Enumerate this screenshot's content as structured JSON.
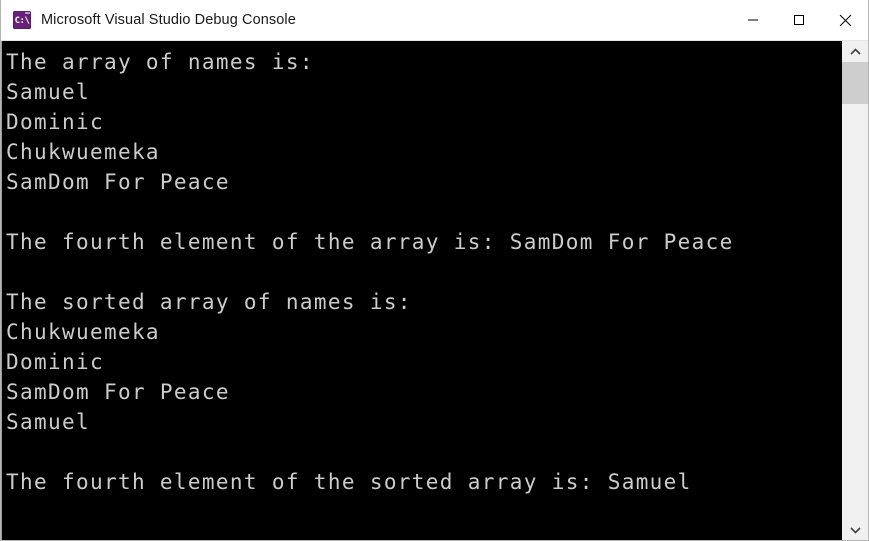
{
  "window": {
    "title": "Microsoft Visual Studio Debug Console",
    "icon_name": "console-app-icon",
    "icon_glyph": "C:\\",
    "icon_color": "#68217a",
    "titlebar_bg": "#ffffff",
    "title_color": "#1a1a1a"
  },
  "controls": {
    "minimize_label": "Minimize",
    "maximize_label": "Maximize",
    "close_label": "Close"
  },
  "console": {
    "background": "#000000",
    "foreground": "#cccccc",
    "lines": [
      "The array of names is:",
      "Samuel",
      "Dominic",
      "Chukwuemeka",
      "SamDom For Peace",
      "",
      "The fourth element of the array is: SamDom For Peace",
      "",
      "The sorted array of names is:",
      "Chukwuemeka",
      "Dominic",
      "SamDom For Peace",
      "Samuel",
      "",
      "The fourth element of the sorted array is: Samuel",
      ""
    ]
  },
  "scrollbar": {
    "up_arrow_label": "Scroll up",
    "down_arrow_label": "Scroll down",
    "thumb_label": "Scroll thumb",
    "thumb_color": "#cdcdcd",
    "track_color": "#f0f0f0"
  }
}
